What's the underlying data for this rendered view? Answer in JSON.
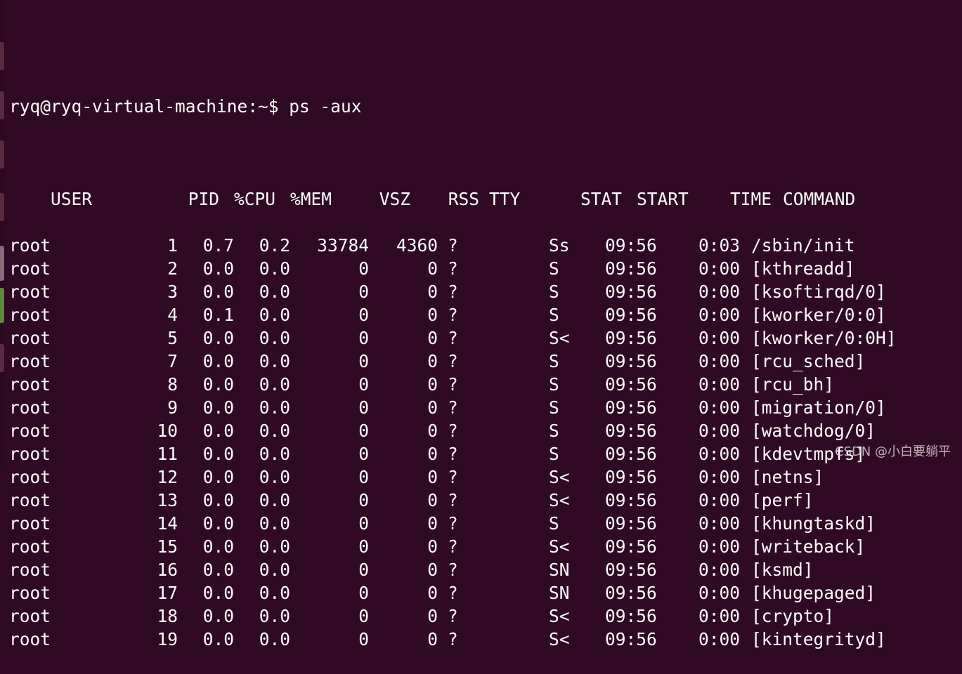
{
  "terminal": {
    "prompt": "ryq@ryq-virtual-machine:~$ ps -aux",
    "header": {
      "user": "USER",
      "pid": "PID",
      "cpu": "%CPU",
      "mem": "%MEM",
      "vsz": "VSZ",
      "rss": "RSS",
      "tty": "TTY",
      "stat": "STAT",
      "start": "START",
      "time": "TIME",
      "command": "COMMAND"
    },
    "rows": [
      {
        "user": "root",
        "pid": "1",
        "cpu": "0.7",
        "mem": "0.2",
        "vsz": "33784",
        "rss": "4360",
        "tty": "?",
        "stat": "Ss",
        "start": "09:56",
        "time": "0:03",
        "command": "/sbin/init"
      },
      {
        "user": "root",
        "pid": "2",
        "cpu": "0.0",
        "mem": "0.0",
        "vsz": "0",
        "rss": "0",
        "tty": "?",
        "stat": "S",
        "start": "09:56",
        "time": "0:00",
        "command": "[kthreadd]"
      },
      {
        "user": "root",
        "pid": "3",
        "cpu": "0.0",
        "mem": "0.0",
        "vsz": "0",
        "rss": "0",
        "tty": "?",
        "stat": "S",
        "start": "09:56",
        "time": "0:00",
        "command": "[ksoftirqd/0]"
      },
      {
        "user": "root",
        "pid": "4",
        "cpu": "0.1",
        "mem": "0.0",
        "vsz": "0",
        "rss": "0",
        "tty": "?",
        "stat": "S",
        "start": "09:56",
        "time": "0:00",
        "command": "[kworker/0:0]"
      },
      {
        "user": "root",
        "pid": "5",
        "cpu": "0.0",
        "mem": "0.0",
        "vsz": "0",
        "rss": "0",
        "tty": "?",
        "stat": "S<",
        "start": "09:56",
        "time": "0:00",
        "command": "[kworker/0:0H]"
      },
      {
        "user": "root",
        "pid": "7",
        "cpu": "0.0",
        "mem": "0.0",
        "vsz": "0",
        "rss": "0",
        "tty": "?",
        "stat": "S",
        "start": "09:56",
        "time": "0:00",
        "command": "[rcu_sched]"
      },
      {
        "user": "root",
        "pid": "8",
        "cpu": "0.0",
        "mem": "0.0",
        "vsz": "0",
        "rss": "0",
        "tty": "?",
        "stat": "S",
        "start": "09:56",
        "time": "0:00",
        "command": "[rcu_bh]"
      },
      {
        "user": "root",
        "pid": "9",
        "cpu": "0.0",
        "mem": "0.0",
        "vsz": "0",
        "rss": "0",
        "tty": "?",
        "stat": "S",
        "start": "09:56",
        "time": "0:00",
        "command": "[migration/0]"
      },
      {
        "user": "root",
        "pid": "10",
        "cpu": "0.0",
        "mem": "0.0",
        "vsz": "0",
        "rss": "0",
        "tty": "?",
        "stat": "S",
        "start": "09:56",
        "time": "0:00",
        "command": "[watchdog/0]"
      },
      {
        "user": "root",
        "pid": "11",
        "cpu": "0.0",
        "mem": "0.0",
        "vsz": "0",
        "rss": "0",
        "tty": "?",
        "stat": "S",
        "start": "09:56",
        "time": "0:00",
        "command": "[kdevtmpfs]"
      },
      {
        "user": "root",
        "pid": "12",
        "cpu": "0.0",
        "mem": "0.0",
        "vsz": "0",
        "rss": "0",
        "tty": "?",
        "stat": "S<",
        "start": "09:56",
        "time": "0:00",
        "command": "[netns]"
      },
      {
        "user": "root",
        "pid": "13",
        "cpu": "0.0",
        "mem": "0.0",
        "vsz": "0",
        "rss": "0",
        "tty": "?",
        "stat": "S<",
        "start": "09:56",
        "time": "0:00",
        "command": "[perf]"
      },
      {
        "user": "root",
        "pid": "14",
        "cpu": "0.0",
        "mem": "0.0",
        "vsz": "0",
        "rss": "0",
        "tty": "?",
        "stat": "S",
        "start": "09:56",
        "time": "0:00",
        "command": "[khungtaskd]"
      },
      {
        "user": "root",
        "pid": "15",
        "cpu": "0.0",
        "mem": "0.0",
        "vsz": "0",
        "rss": "0",
        "tty": "?",
        "stat": "S<",
        "start": "09:56",
        "time": "0:00",
        "command": "[writeback]"
      },
      {
        "user": "root",
        "pid": "16",
        "cpu": "0.0",
        "mem": "0.0",
        "vsz": "0",
        "rss": "0",
        "tty": "?",
        "stat": "SN",
        "start": "09:56",
        "time": "0:00",
        "command": "[ksmd]"
      },
      {
        "user": "root",
        "pid": "17",
        "cpu": "0.0",
        "mem": "0.0",
        "vsz": "0",
        "rss": "0",
        "tty": "?",
        "stat": "SN",
        "start": "09:56",
        "time": "0:00",
        "command": "[khugepaged]"
      },
      {
        "user": "root",
        "pid": "18",
        "cpu": "0.0",
        "mem": "0.0",
        "vsz": "0",
        "rss": "0",
        "tty": "?",
        "stat": "S<",
        "start": "09:56",
        "time": "0:00",
        "command": "[crypto]"
      },
      {
        "user": "root",
        "pid": "19",
        "cpu": "0.0",
        "mem": "0.0",
        "vsz": "0",
        "rss": "0",
        "tty": "?",
        "stat": "S<",
        "start": "09:56",
        "time": "0:00",
        "command": "[kintegrityd]"
      }
    ]
  },
  "watermark": "CSDN @小白要躺平",
  "colors": {
    "background": "#300a24",
    "foreground": "#ffffff"
  }
}
